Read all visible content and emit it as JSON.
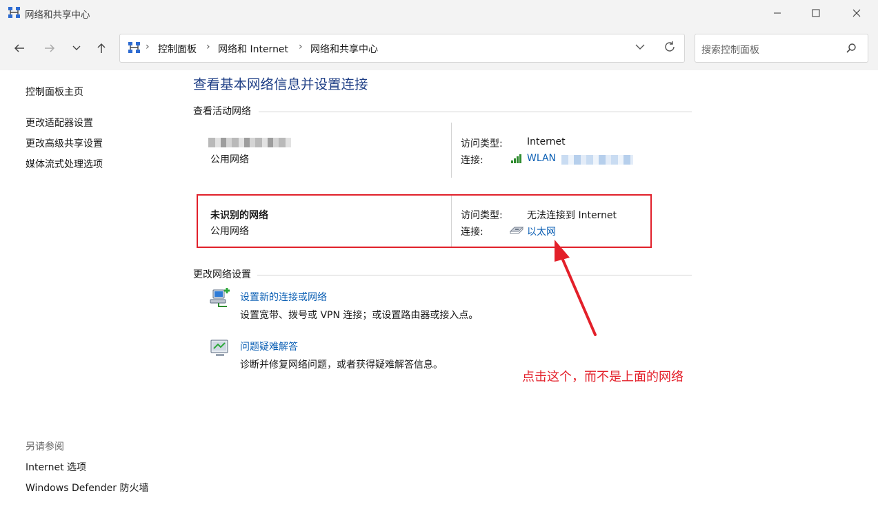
{
  "window": {
    "title": "网络和共享中心"
  },
  "breadcrumb": [
    "控制面板",
    "网络和 Internet",
    "网络和共享中心"
  ],
  "search": {
    "placeholder": "搜索控制面板"
  },
  "sidebar": {
    "items": [
      "控制面板主页",
      "更改适配器设置",
      "更改高级共享设置",
      "媒体流式处理选项"
    ],
    "see_also_heading": "另请参阅",
    "see_also": [
      "Internet 选项",
      "Windows Defender 防火墙"
    ]
  },
  "main": {
    "title": "查看基本网络信息并设置连接",
    "active_networks_heading": "查看活动网络",
    "networks": [
      {
        "name": "",
        "category": "公用网络",
        "access_label": "访问类型:",
        "access_value": "Internet",
        "conn_label": "连接:",
        "conn_value": "WLAN"
      },
      {
        "name": "未识别的网络",
        "category": "公用网络",
        "access_label": "访问类型:",
        "access_value": "无法连接到 Internet",
        "conn_label": "连接:",
        "conn_value": "以太网"
      }
    ],
    "change_heading": "更改网络设置",
    "tasks": [
      {
        "title": "设置新的连接或网络",
        "desc": "设置宽带、拨号或 VPN 连接；或设置路由器或接入点。",
        "icon": "network-setup-icon"
      },
      {
        "title": "问题疑难解答",
        "desc": "诊断并修复网络问题，或者获得疑难解答信息。",
        "icon": "troubleshoot-icon"
      }
    ]
  },
  "annotation": {
    "text": "点击这个，而不是上面的网络",
    "color": "#e3202a"
  }
}
